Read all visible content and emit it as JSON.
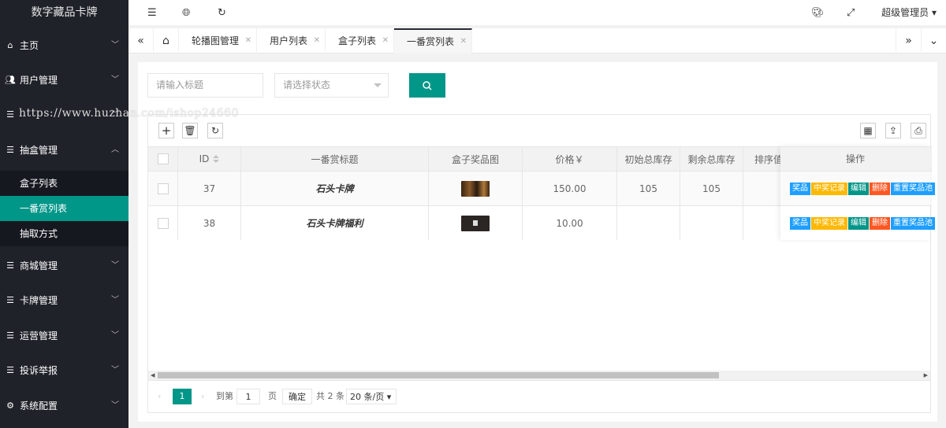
{
  "app": {
    "title": "数字藏品卡牌"
  },
  "sidebar": {
    "items": [
      {
        "label": "主页",
        "icon": "home-icon"
      },
      {
        "label": "用户管理",
        "icon": "users-icon"
      },
      {
        "label": "",
        "icon": "list-icon"
      },
      {
        "label": "抽盒管理",
        "icon": "list-icon",
        "expanded": true,
        "children": [
          {
            "label": "盒子列表",
            "active": false
          },
          {
            "label": "一番赏列表",
            "active": true
          },
          {
            "label": "抽取方式",
            "active": false
          }
        ]
      },
      {
        "label": "商城管理",
        "icon": "list-icon"
      },
      {
        "label": "卡牌管理",
        "icon": "list-icon"
      },
      {
        "label": "运营管理",
        "icon": "list-icon"
      },
      {
        "label": "投诉举报",
        "icon": "list-icon"
      },
      {
        "label": "系统配置",
        "icon": "settings-icon"
      }
    ]
  },
  "header": {
    "admin_label": "超级管理员",
    "icons": [
      "menu-fold-icon",
      "globe-icon",
      "refresh-icon",
      "theme-icon",
      "fullscreen-icon"
    ]
  },
  "tabs": {
    "items": [
      {
        "label": "轮播图管理",
        "active": false
      },
      {
        "label": "用户列表",
        "active": false
      },
      {
        "label": "盒子列表",
        "active": false
      },
      {
        "label": "一番赏列表",
        "active": true
      }
    ]
  },
  "search": {
    "title_placeholder": "请输入标题",
    "status_placeholder": "请选择状态"
  },
  "table": {
    "columns": [
      "",
      "ID",
      "一番赏标题",
      "盒子奖品图",
      "价格￥",
      "初始总库存",
      "剩余总库存",
      "排序值",
      "操作"
    ],
    "rows": [
      {
        "id": "37",
        "title": "石头卡牌",
        "price": "150.00",
        "init_stock": "105",
        "remain_stock": "105",
        "thumb_color": "#5a3b1e"
      },
      {
        "id": "38",
        "title": "石头卡牌福利",
        "price": "10.00",
        "init_stock": "",
        "remain_stock": "",
        "thumb_color": "#2b2523"
      }
    ],
    "actions": [
      {
        "label": "奖品",
        "color": "#1e9fff"
      },
      {
        "label": "中奖记录",
        "color": "#ffb800"
      },
      {
        "label": "编辑",
        "color": "#009688"
      },
      {
        "label": "删除",
        "color": "#ff5722"
      },
      {
        "label": "重置奖品池",
        "color": "#1e9fff"
      }
    ]
  },
  "pager": {
    "current": "1",
    "goto_label": "到第",
    "goto_value": "1",
    "page_unit": "页",
    "confirm_label": "确定",
    "total_label": "共 2 条",
    "page_size": "20 条/页"
  },
  "watermark": "https://www.huzhan.com/ishop24660"
}
